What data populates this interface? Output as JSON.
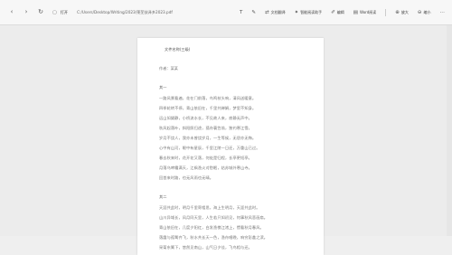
{
  "toolbar": {
    "url_label": "打开",
    "url": "C:/Users/Desktop/Writing/2023/莱芜扶泽乡2023.pdf",
    "left_icons": [
      "back-icon",
      "forward-icon",
      "refresh-icon",
      "info-icon"
    ],
    "tools": [
      {
        "icon": "text-icon",
        "label": ""
      },
      {
        "icon": "highlight-icon",
        "label": ""
      },
      {
        "icon": "pen-icon",
        "label": ""
      },
      {
        "icon": "translate-icon",
        "label": "文档翻译"
      },
      {
        "icon": "ai-icon",
        "label": "智能阅读助手"
      },
      {
        "icon": "edit-icon",
        "label": "编辑"
      },
      {
        "icon": "read-icon",
        "label": "Word阅读"
      }
    ],
    "zoom_in": "放大",
    "zoom_out": "缩小"
  },
  "document": {
    "header": "文件名称(三级)",
    "author": "作者：某某",
    "sections": [
      {
        "title": "其一",
        "lines": [
          "一路风景看遍，花在门前落，鸟鸣枝头响，清风送暖意。",
          "四季轮转不停，青山依旧在，千里共婵娟，梦里不知身。",
          "远山如黛静，小桥流水长，不见故人来，寂静无声中。",
          "秋风起落叶，斜阳照归途，孤舟蓑笠翁，独钓寒江雪。",
          "岁月不饶人，我亦未曾饶岁月，一生等候，无怨亦无悔。",
          "心中有山河，眼中有星辰，千里江陵一日还，万重山已过。",
          "春去秋来时，花开花又落，何处是归程，长亭更短亭。",
          "月落乌啼霜满天，江枫渔火对愁眠，姑苏城外寒山寺。",
          "回首来时路，也无风雨也无晴。"
        ]
      },
      {
        "title": "其二",
        "lines": [
          "天涯共此时，明月千里寄相思，海上生明月，天涯共此时。",
          "山川异域长，风月同天里，人生若只如初见，何事秋风悲画扇。",
          "青山依旧在，几度夕阳红，白发渔樵江渚上，惯看秋月春风。",
          "落霞与孤鹜齐飞，秋水共长天一色，渔舟唱晚，响穷彭蠡之滨。",
          "采菊东篱下，悠然见南山，山气日夕佳，飞鸟相与还。"
        ]
      }
    ]
  }
}
